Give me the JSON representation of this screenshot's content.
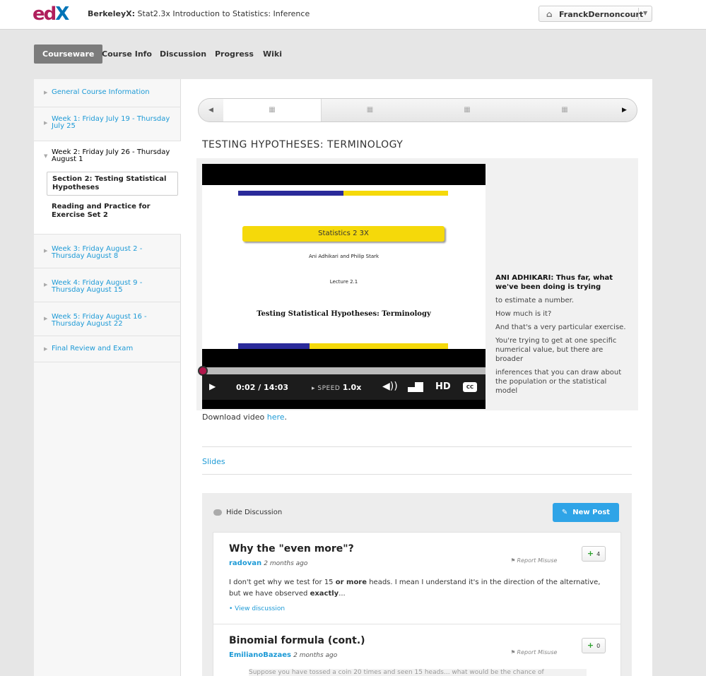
{
  "header": {
    "logo_text": "edX",
    "course_org": "BerkeleyX:",
    "course_title": "Stat2.3x Introduction to Statistics: Inference",
    "user_name": "FranckDernoncourt",
    "home_icon": "home-icon",
    "caret_icon": "chevron-down-icon"
  },
  "tabs": [
    {
      "label": "Courseware",
      "active": true
    },
    {
      "label": "Course Info",
      "active": false
    },
    {
      "label": "Discussion",
      "active": false
    },
    {
      "label": "Progress",
      "active": false
    },
    {
      "label": "Wiki",
      "active": false
    }
  ],
  "sidebar": {
    "chapters": [
      {
        "label": "General Course Information"
      },
      {
        "label": "Week 1: Friday July 19 - Thursday July 25"
      },
      {
        "label": "Week 2: Friday July 26 - Thursday August 1"
      },
      {
        "label": "Week 3: Friday August 2 - Thursday August 8"
      },
      {
        "label": "Week 4: Friday August 9 - Thursday August 15"
      },
      {
        "label": "Week 5: Friday August 16 - Thursday August 22"
      },
      {
        "label": "Final Review and Exam"
      }
    ],
    "sections": [
      {
        "label": "Section 2: Testing Statistical Hypotheses",
        "active": true
      },
      {
        "label": "Reading and Practice for Exercise Set 2",
        "active": false
      }
    ]
  },
  "sequence": {
    "prev_icon": "◀",
    "next_icon": "▶",
    "item_icon": "🎞"
  },
  "unit": {
    "title": "TESTING HYPOTHESES: TERMINOLOGY"
  },
  "video": {
    "slide_title": "Statistics 2 3X",
    "slide_authors": "Ani Adhikari and Philip Stark",
    "slide_lecture": "Lecture 2.1",
    "slide_heading": "Testing Statistical Hypotheses: Terminology",
    "time": "0:02 / 14:03",
    "speed_label": "SPEED",
    "speed_value": "1.0x",
    "hd_label": "HD",
    "cc_label": "CC",
    "progress": 0.002,
    "colors": {
      "scrub_dot": "#b2164b",
      "slide_yellow": "#f5d90a",
      "slide_blue": "#2a2a9a"
    }
  },
  "transcript": {
    "lines": [
      {
        "text": "ANI ADHIKARI: Thus far, what we've been doing is trying",
        "current": true
      },
      {
        "text": "to estimate a number.",
        "current": false
      },
      {
        "text": "How much is it?",
        "current": false
      },
      {
        "text": "And that's a very particular exercise.",
        "current": false
      },
      {
        "text": "You're trying to get at one specific numerical value, but there are broader",
        "current": false
      },
      {
        "text": "inferences that you can draw about the population or the statistical model",
        "current": false
      }
    ]
  },
  "download": {
    "prefix": "Download video",
    "link": "here",
    "suffix": "."
  },
  "slides_link": "Slides",
  "discussion": {
    "hide_label": "Hide Discussion",
    "new_post_label": "New Post",
    "report_label": "Report Misuse",
    "view_label": "• View discussion",
    "threads": [
      {
        "title": "Why the \"even more\"?",
        "author": "radovan",
        "time": "2 months ago",
        "votes": "4",
        "body_1": "I don't get why we test for 15",
        "body_bold_1": "or more",
        "body_2": "heads. I mean I understand it's in the direction of the alternative, but we have observed",
        "body_bold_2": "exactly",
        "body_3": "..."
      },
      {
        "title": "Binomial formula (cont.)",
        "author": "EmilianoBazaes",
        "time": "2 months ago",
        "votes": "0",
        "preview": "Suppose you have tossed a coin 20 times and seen 15 heads... what would be the chance of"
      }
    ]
  },
  "colors": {
    "link": "#1d9ad6",
    "brand_magenta": "#b01f5c",
    "brand_blue": "#0074b7",
    "new_post_bg": "#2fa4e7"
  }
}
